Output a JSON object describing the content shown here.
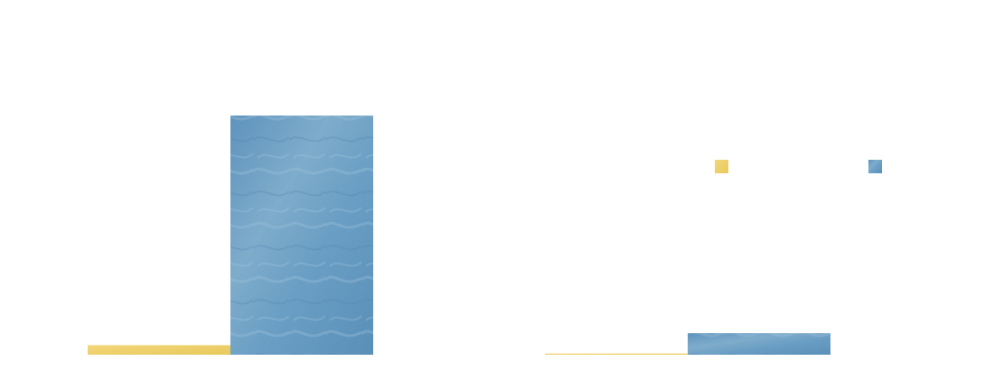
{
  "chart_data": [
    {
      "type": "bar",
      "categories": [
        "",
        ""
      ],
      "series": [
        {
          "values": [
            4,
            100
          ]
        }
      ],
      "colors": [
        "#efd16c",
        "#6f9fc4"
      ],
      "ylim": [
        0,
        100
      ],
      "grid": false,
      "legend": "none"
    },
    {
      "type": "bar",
      "categories": [
        "",
        ""
      ],
      "series": [
        {
          "values": [
            0.5,
            9
          ]
        }
      ],
      "colors": [
        "#efd16c",
        "#6f9fc4"
      ],
      "ylim": [
        0,
        100
      ],
      "grid": false,
      "legend": "top-right",
      "legend_entries": [
        {
          "label": "",
          "color": "#efd16c"
        },
        {
          "label": "",
          "color": "#6f9fc4"
        }
      ]
    }
  ]
}
